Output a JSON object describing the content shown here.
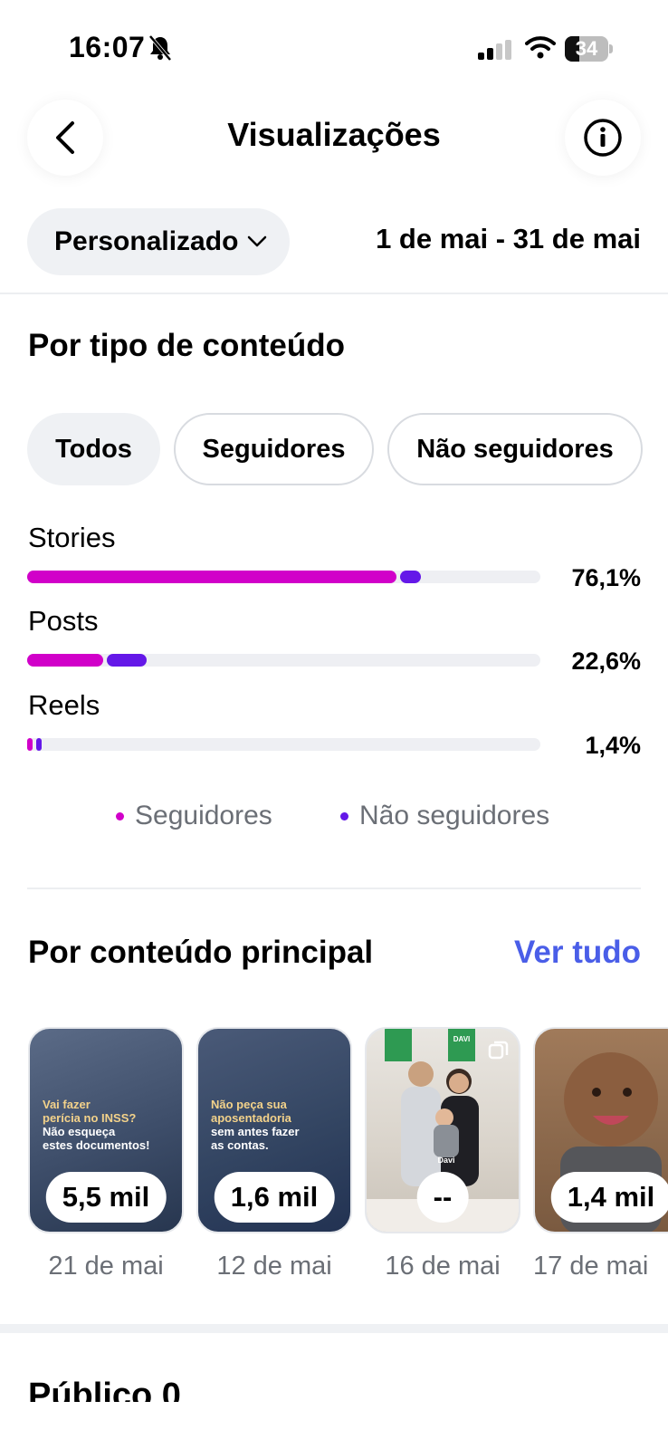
{
  "status_bar": {
    "time": "16:07",
    "battery": "34"
  },
  "header": {
    "title": "Visualizações"
  },
  "filter": {
    "period_label": "Personalizado",
    "date_range": "1 de mai - 31 de mai"
  },
  "content_type": {
    "title": "Por tipo de conteúdo",
    "chips": [
      "Todos",
      "Seguidores",
      "Não seguidores"
    ],
    "active_chip": "Todos",
    "rows": [
      {
        "label": "Stories",
        "percent": "76,1%",
        "followers_pct": 71.9,
        "non_followers_pct": 4.2
      },
      {
        "label": "Posts",
        "percent": "22,6%",
        "followers_pct": 14.9,
        "non_followers_pct": 7.7
      },
      {
        "label": "Reels",
        "percent": "1,4%",
        "followers_pct": 0.7,
        "non_followers_pct": 0.7
      }
    ],
    "legend": {
      "followers": "Seguidores",
      "non_followers": "Não seguidores"
    },
    "colors": {
      "followers": "#d100c9",
      "non_followers": "#6418e8",
      "track": "#eeeff3"
    }
  },
  "top_content": {
    "title": "Por conteúdo principal",
    "see_all": "Ver tudo",
    "items": [
      {
        "count": "5,5 mil",
        "date": "21 de mai",
        "overlay_line1": "Vai fazer",
        "overlay_line2": "perícia no INSS?",
        "overlay_line3": "Não esqueça",
        "overlay_line4": "estes documentos!"
      },
      {
        "count": "1,6 mil",
        "date": "12 de mai",
        "overlay_line1": "Não peça sua",
        "overlay_line2": "aposentadoria",
        "overlay_line3": "sem antes fazer",
        "overlay_line4": "as contas."
      },
      {
        "count": "--",
        "date": "16 de mai",
        "sign_name": "DAVI",
        "shirt_name": "Davi"
      },
      {
        "count": "1,4 mil",
        "date": "17 de mai"
      }
    ]
  },
  "next_section": {
    "title": "Público 0"
  }
}
